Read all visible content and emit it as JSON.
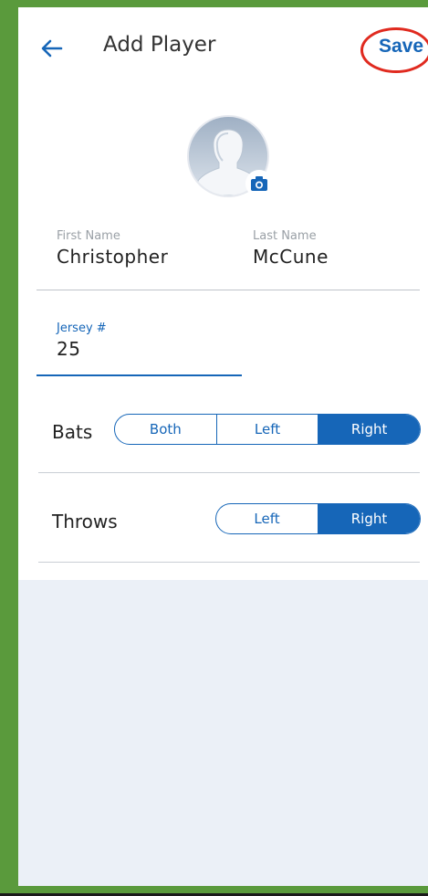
{
  "header": {
    "title": "Add Player",
    "save_label": "Save",
    "back_icon": "arrow-left-icon"
  },
  "avatar": {
    "icon": "person-silhouette-icon",
    "camera_icon": "camera-icon"
  },
  "form": {
    "first_name": {
      "label": "First Name",
      "value": "Christopher"
    },
    "last_name": {
      "label": "Last Name",
      "value": "McCune"
    },
    "jersey": {
      "label": "Jersey #",
      "value": "25"
    }
  },
  "bats": {
    "label": "Bats",
    "options": [
      "Both",
      "Left",
      "Right"
    ],
    "selected": "Right"
  },
  "throws": {
    "label": "Throws",
    "options": [
      "Left",
      "Right"
    ],
    "selected": "Right"
  },
  "colors": {
    "accent": "#1666b8",
    "annotation_ring": "#e02a1f",
    "frame": "#5a9a3c",
    "bottom_bg": "#ebf0f7"
  }
}
